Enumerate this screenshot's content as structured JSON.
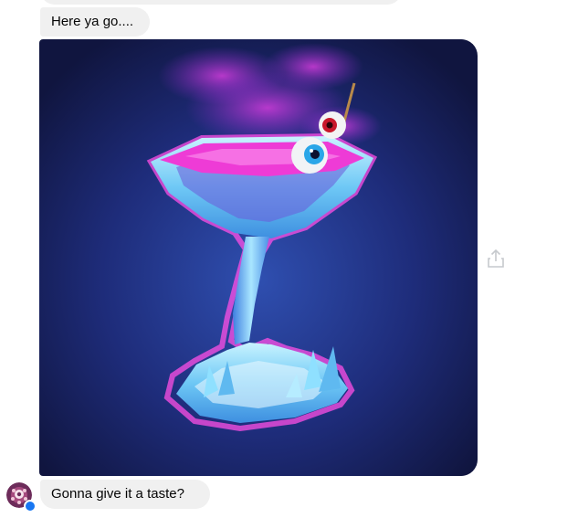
{
  "conversation": {
    "messages": [
      {
        "type": "text",
        "text": "Here ya go...."
      },
      {
        "type": "image",
        "icon": "sticker-cocktail-glass-with-eyeballs-image"
      },
      {
        "type": "text",
        "text": "Gonna give it a taste?"
      }
    ],
    "share_icon": "share-icon",
    "avatar_icon": "avatar-icon"
  },
  "colors": {
    "bubble_background": "#f0f0f0",
    "image_background": "#1a2160",
    "liquid": "#ee3bd6",
    "glass": "#7fd8ff",
    "presence_badge": "#1877f2"
  }
}
